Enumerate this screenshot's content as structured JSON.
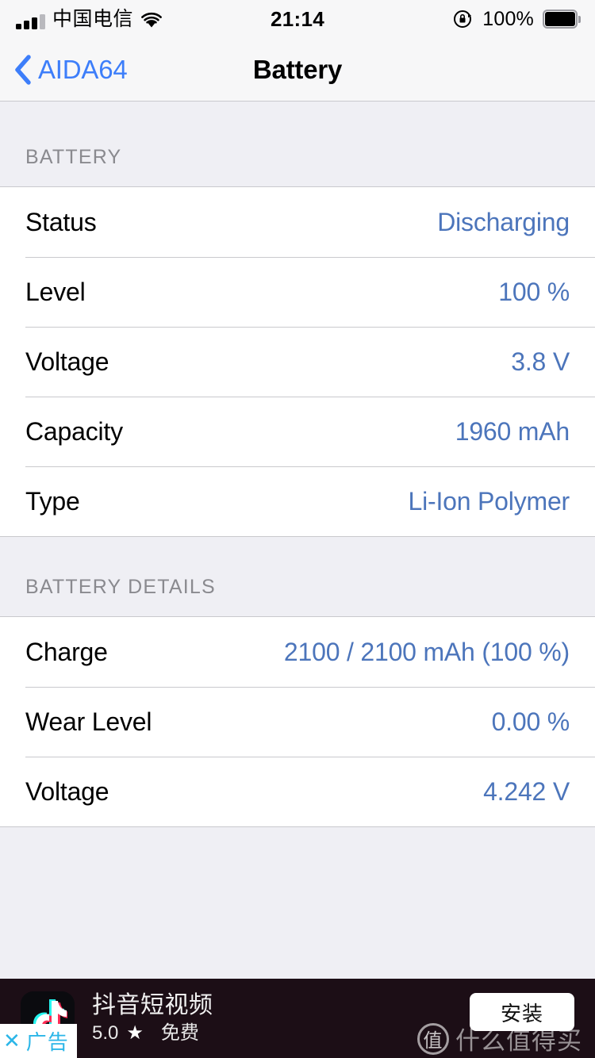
{
  "status_bar": {
    "carrier": "中国电信",
    "time": "21:14",
    "battery_percent": "100%",
    "signal_icon": "signal-bars-icon",
    "wifi_icon": "wifi-icon",
    "rotation_lock_icon": "rotation-lock-icon",
    "battery_icon": "battery-full-icon"
  },
  "nav": {
    "back_label": "AIDA64",
    "back_icon": "chevron-left-icon",
    "title": "Battery"
  },
  "sections": [
    {
      "header": "BATTERY",
      "rows": [
        {
          "label": "Status",
          "value": "Discharging"
        },
        {
          "label": "Level",
          "value": "100 %"
        },
        {
          "label": "Voltage",
          "value": "3.8 V"
        },
        {
          "label": "Capacity",
          "value": "1960 mAh"
        },
        {
          "label": "Type",
          "value": "Li-Ion Polymer"
        }
      ]
    },
    {
      "header": "BATTERY DETAILS",
      "rows": [
        {
          "label": "Charge",
          "value": "2100 / 2100 mAh (100 %)"
        },
        {
          "label": "Wear Level",
          "value": "0.00 %"
        },
        {
          "label": "Voltage",
          "value": "4.242 V"
        }
      ]
    }
  ],
  "ad": {
    "app_name": "抖音短视频",
    "rating": "5.0",
    "star_glyph": "★",
    "price": "免费",
    "install_label": "安装",
    "close_label": "广告",
    "close_x": "✕",
    "app_icon": "tiktok-logo-icon",
    "watermark_badge": "值",
    "watermark_text": "什么值得买"
  },
  "colors": {
    "accent_blue": "#3D7EFA",
    "value_blue": "#4C75BB",
    "group_bg": "#EFEFF4",
    "row_bg": "#FFFFFF",
    "separator": "#C9C9CD",
    "header_text": "#8A8A8F",
    "ad_bg": "#1C0E16"
  }
}
